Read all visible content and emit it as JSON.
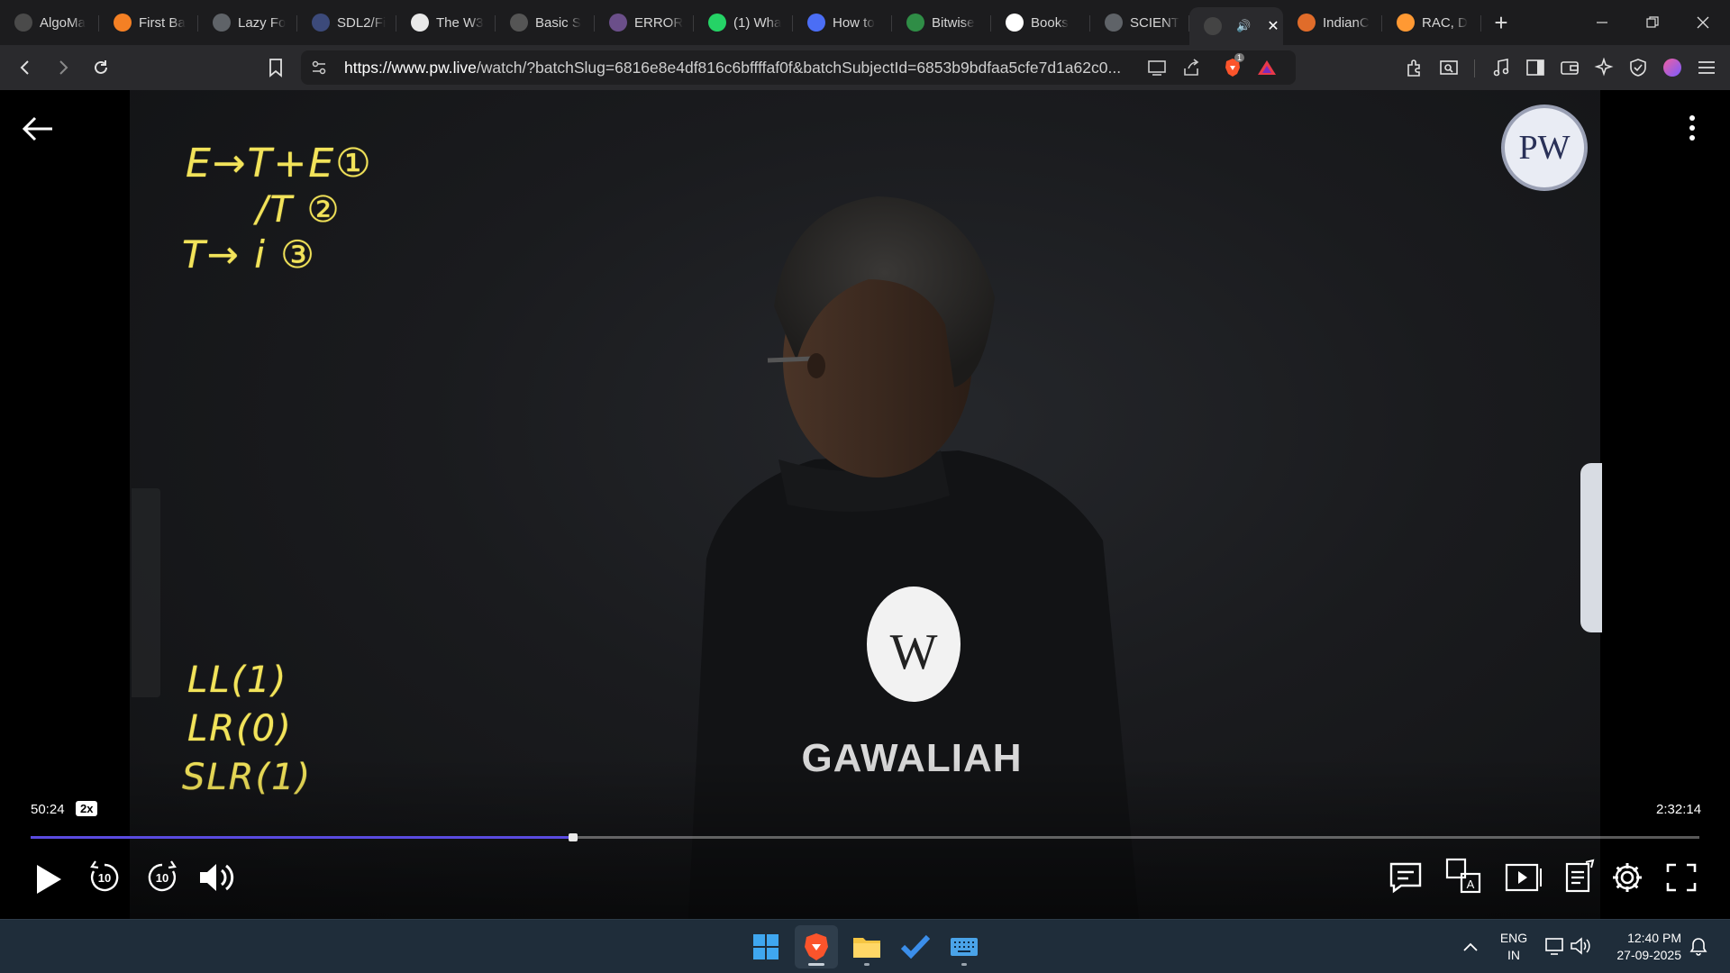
{
  "browser": {
    "tabs": [
      {
        "title": "AlgoMa",
        "icon": "algomaster-icon",
        "color": "#4a4a4a"
      },
      {
        "title": "First Ba",
        "icon": "stack-icon",
        "color": "#f48024"
      },
      {
        "title": "Lazy Fo",
        "icon": "globe-icon",
        "color": "#5f6368"
      },
      {
        "title": "SDL2/Fi",
        "icon": "sdl-icon",
        "color": "#3c4a7a"
      },
      {
        "title": "The W3",
        "icon": "w3-icon",
        "color": "#e9e9e9"
      },
      {
        "title": "Basic S",
        "icon": "doc-icon",
        "color": "#555"
      },
      {
        "title": "ERROR",
        "icon": "error-icon",
        "color": "#6b4f8a"
      },
      {
        "title": "(1) Wha",
        "icon": "whatsapp-icon",
        "color": "#25d366"
      },
      {
        "title": "How to",
        "icon": "bookmark-icon",
        "color": "#4b6ef5"
      },
      {
        "title": "Bitwise",
        "icon": "gfg-icon",
        "color": "#2f8d46"
      },
      {
        "title": "Books",
        "icon": "google-icon",
        "color": "#ffffff"
      },
      {
        "title": "SCIENT",
        "icon": "globe-icon",
        "color": "#5f6368"
      },
      {
        "title": "",
        "icon": "audio-icon",
        "color": "#444",
        "active": true
      },
      {
        "title": "IndianC",
        "icon": "indianc-icon",
        "color": "#e06c2a"
      },
      {
        "title": "RAC, D",
        "icon": "india-flag-icon",
        "color": "#ff9933"
      }
    ],
    "new_tab": "+",
    "url_host": "https://www.pw.live",
    "url_rest": "/watch/?batchSlug=6816e8e4df816c6bffffaf0f&batchSubjectId=6853b9bdfaa5cfe7d1a62c0...",
    "brave_badge": "1"
  },
  "player": {
    "board_lines": [
      "E→T+E①",
      "/T ②",
      "T→ i  ③"
    ],
    "board_lines2": [
      "LL(1)",
      "LR(0)",
      "SLR(1)"
    ],
    "logo_text": "PW",
    "shirt_text": "GAWALIAH",
    "current_time": "50:24",
    "speed": "2x",
    "total_time": "2:32:14",
    "progress": 0.3246,
    "rewind_label": "10",
    "forward_label": "10"
  },
  "taskbar": {
    "lang_top": "ENG",
    "lang_bottom": "IN",
    "time": "12:40 PM",
    "date": "27-09-2025"
  }
}
